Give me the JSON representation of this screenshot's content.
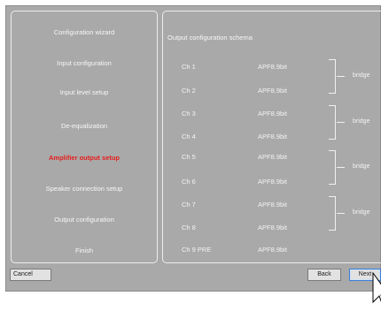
{
  "sidebar": {
    "items": [
      {
        "label": "Configuration wizard",
        "active": false
      },
      {
        "label": "Input configuration",
        "active": false
      },
      {
        "label": "Input level setup",
        "active": false
      },
      {
        "label": "De-equalization",
        "active": false
      },
      {
        "label": "Amplifier output setup",
        "active": true
      },
      {
        "label": "Speaker connection setup",
        "active": false
      },
      {
        "label": "Output configuration",
        "active": false
      },
      {
        "label": "Finish",
        "active": false
      }
    ]
  },
  "panel": {
    "title": "Output configuration schema",
    "channels": [
      {
        "name": "Ch 1",
        "model": "APF8.9bit"
      },
      {
        "name": "Ch 2",
        "model": "APF8.9bit"
      },
      {
        "name": "Ch 3",
        "model": "APF8.9bit"
      },
      {
        "name": "Ch 4",
        "model": "APF8.9bit"
      },
      {
        "name": "Ch 5",
        "model": "APF8.9bit"
      },
      {
        "name": "Ch 6",
        "model": "APF8.9bit"
      },
      {
        "name": "Ch 7",
        "model": "APF8.9bit"
      },
      {
        "name": "Ch 8",
        "model": "APF8.9bit"
      },
      {
        "name": "Ch 9  PRE",
        "model": "APF8.9bit"
      }
    ],
    "bridges": [
      {
        "label": "bridge"
      },
      {
        "label": "bridge"
      },
      {
        "label": "bridge"
      },
      {
        "label": "bridge"
      }
    ]
  },
  "buttons": {
    "cancel": "Cancel",
    "back": "Back",
    "next": "Next"
  },
  "colors": {
    "window_bg": "#a9a9a9",
    "active_step": "#e81d1d",
    "text": "#f7f7f7"
  }
}
